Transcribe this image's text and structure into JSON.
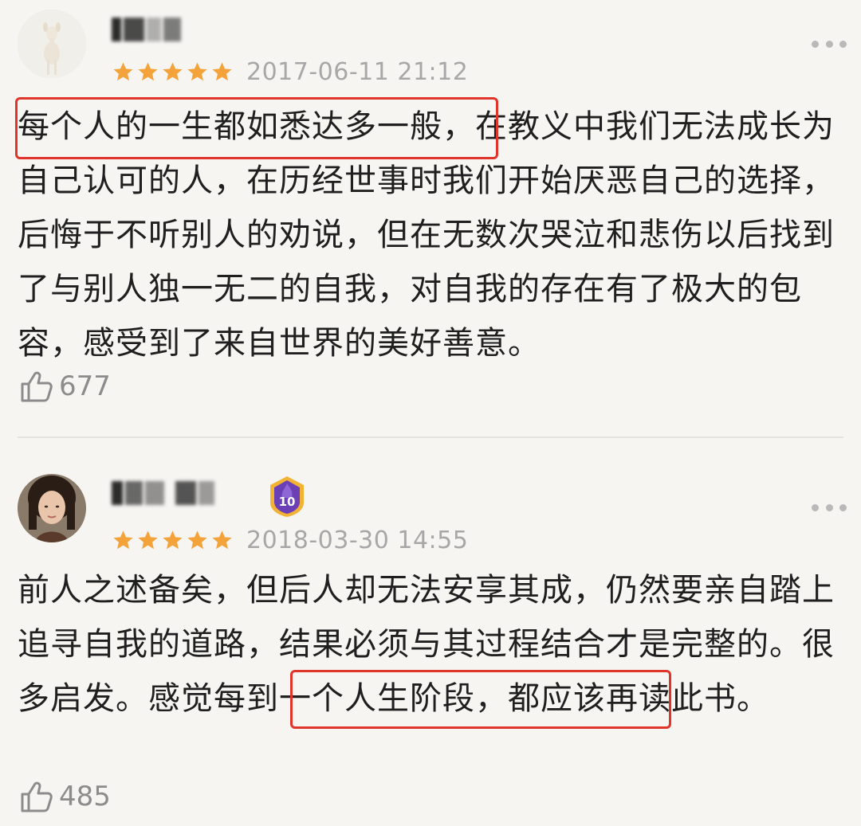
{
  "reviews": [
    {
      "username": "",
      "rating_stars": 5,
      "date": "2017-06-11 21:12",
      "text": "每个人的一生都如悉达多一般，在教义中我们无法成长为自己认可的人，在历经世事时我们开始厌恶自己的选择，后悔于不听别人的劝说，但在无数次哭泣和悲伤以后找到了与别人独一无二的自我，对自我的存在有了极大的包容，感受到了来自世界的美好善意。",
      "highlighted_phrase": "每个人的一生都如悉达多一般，",
      "likes": "677",
      "avatar_icon": "fawn-figurine-avatar"
    },
    {
      "username": "",
      "level_badge": "10",
      "rating_stars": 5,
      "date": "2018-03-30 14:55",
      "text": "前人之述备矣，但后人却无法安享其成，仍然要亲自踏上追寻自我的道路，结果必须与其过程结合才是完整的。很多启发。感觉每到一个人生阶段，都应该再读此书。",
      "highlighted_phrase": "感觉每到一个人生阶段，",
      "likes": "485",
      "avatar_icon": "woman-portrait-avatar"
    }
  ],
  "colors": {
    "star": "#f4a23a",
    "highlight_box": "#e0352b",
    "date_text": "#a7a7a7",
    "background": "#f6f5f2",
    "badge_purple": "#6b3fb5",
    "badge_gold": "#f2b233"
  },
  "icons": {
    "like": "thumbs-up-icon",
    "more": "more-dots-icon",
    "star": "star-icon"
  }
}
